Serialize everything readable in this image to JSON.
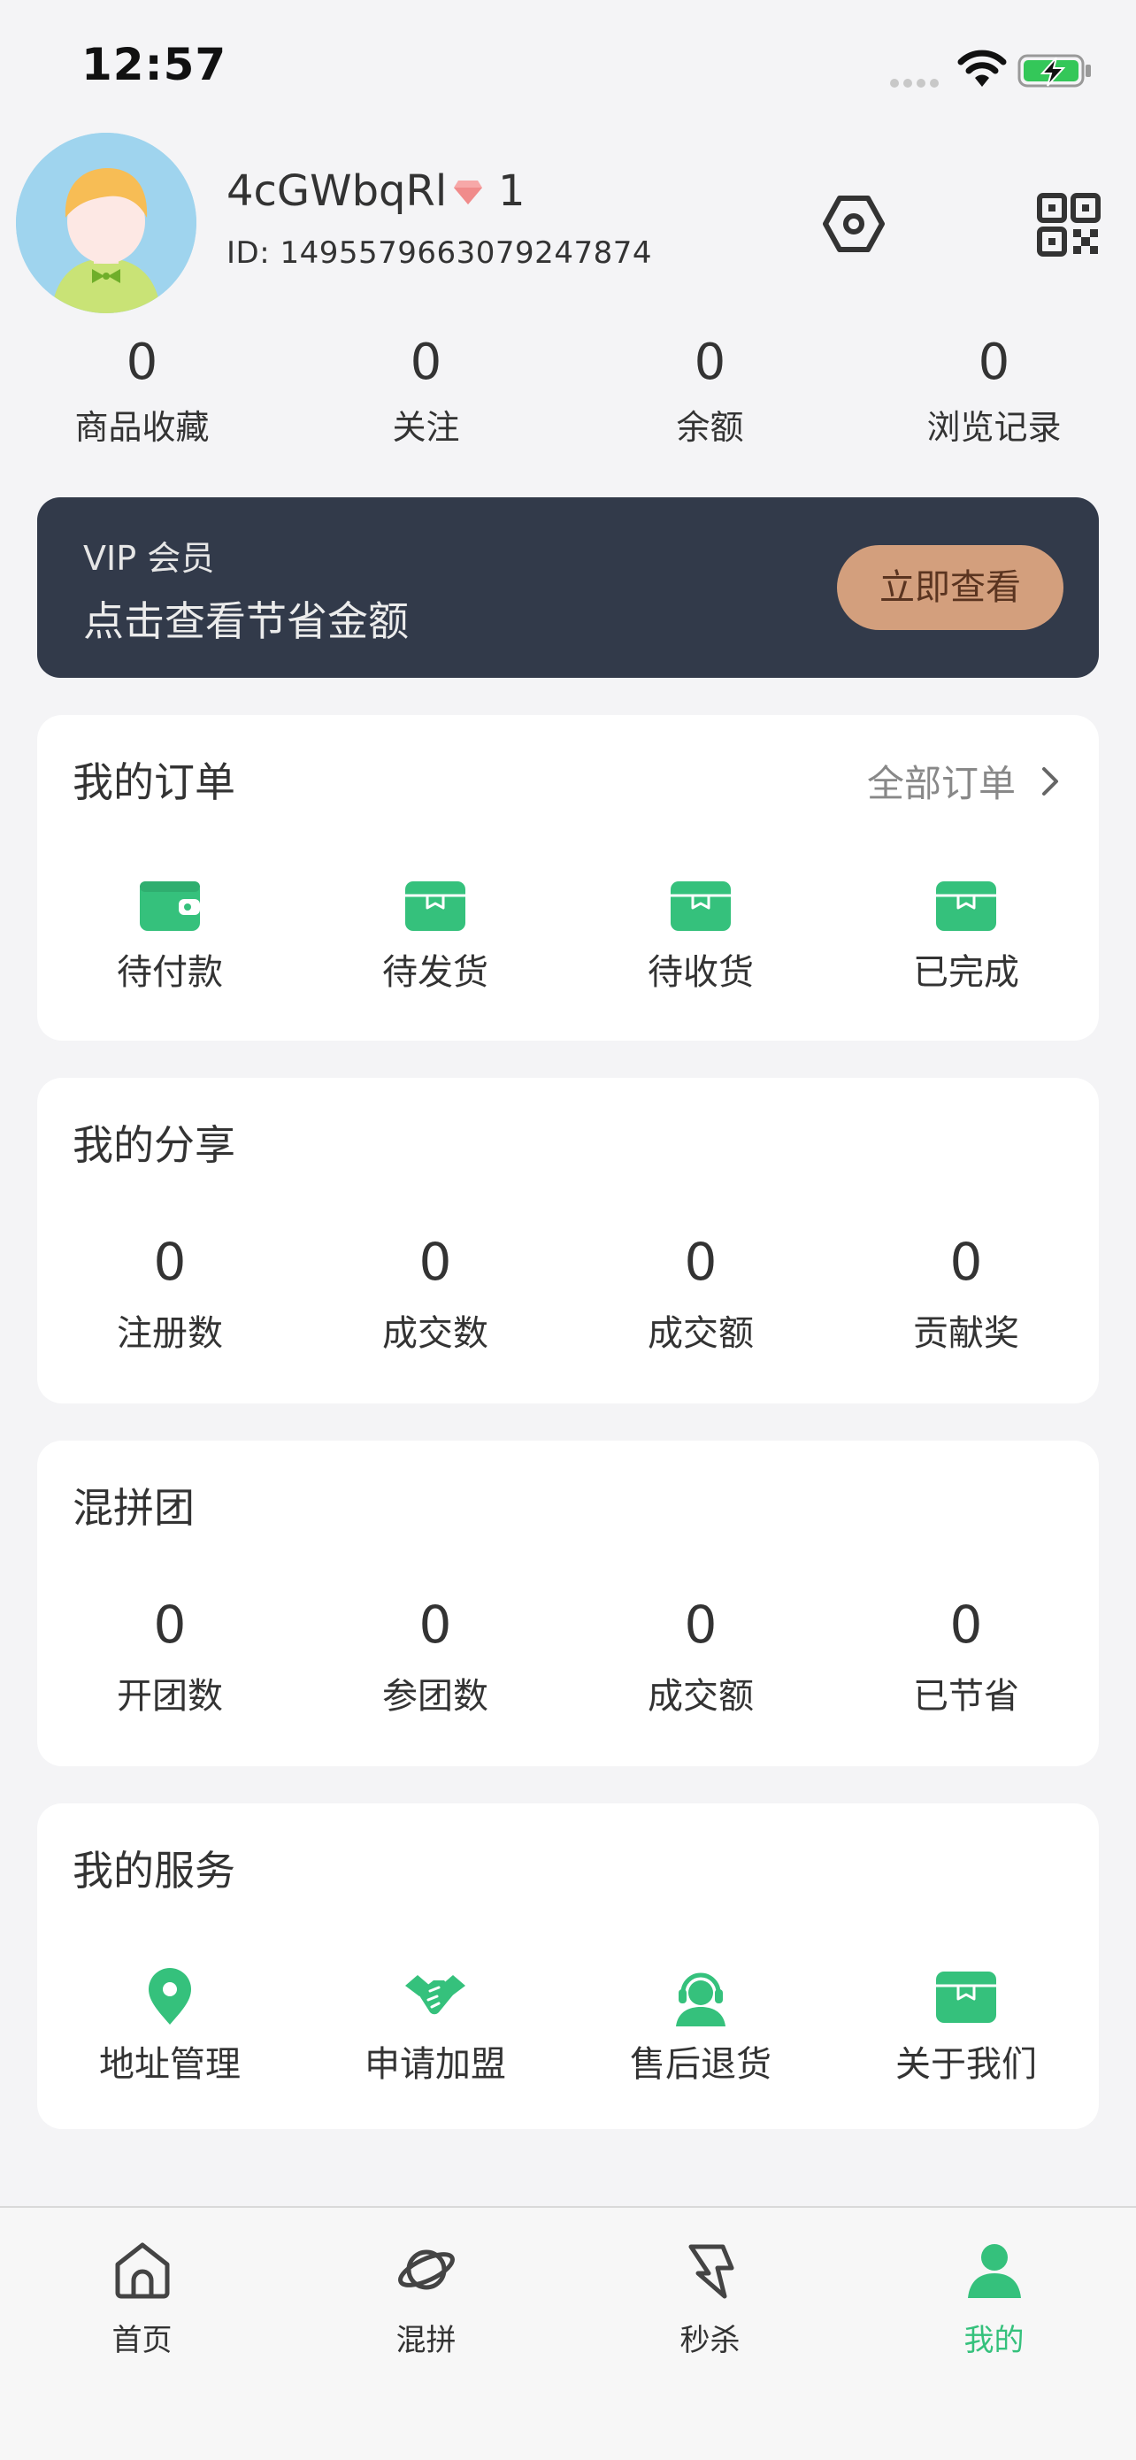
{
  "status_bar": {
    "time": "12:57"
  },
  "profile": {
    "username": "4cGWbqRl",
    "level": "1",
    "user_id": "ID: 1495579663079247874"
  },
  "stats": [
    {
      "value": "0",
      "label": "商品收藏"
    },
    {
      "value": "0",
      "label": "关注"
    },
    {
      "value": "0",
      "label": "余额"
    },
    {
      "value": "0",
      "label": "浏览记录"
    }
  ],
  "vip": {
    "title": "VIP 会员",
    "subtitle": "点击查看节省金额",
    "button": "立即查看"
  },
  "orders": {
    "title": "我的订单",
    "link": "全部订单",
    "items": [
      {
        "label": "待付款",
        "icon": "wallet-icon"
      },
      {
        "label": "待发货",
        "icon": "box-icon"
      },
      {
        "label": "待收货",
        "icon": "box-icon"
      },
      {
        "label": "已完成",
        "icon": "box-icon"
      }
    ]
  },
  "share": {
    "title": "我的分享",
    "items": [
      {
        "value": "0",
        "label": "注册数"
      },
      {
        "value": "0",
        "label": "成交数"
      },
      {
        "value": "0",
        "label": "成交额"
      },
      {
        "value": "0",
        "label": "贡献奖"
      }
    ]
  },
  "group": {
    "title": "混拼团",
    "items": [
      {
        "value": "0",
        "label": "开团数"
      },
      {
        "value": "0",
        "label": "参团数"
      },
      {
        "value": "0",
        "label": "成交额"
      },
      {
        "value": "0",
        "label": "已节省"
      }
    ]
  },
  "services": {
    "title": "我的服务",
    "items": [
      {
        "label": "地址管理",
        "icon": "location-pin-icon"
      },
      {
        "label": "申请加盟",
        "icon": "handshake-icon"
      },
      {
        "label": "售后退货",
        "icon": "customer-service-icon"
      },
      {
        "label": "关于我们",
        "icon": "box-icon"
      }
    ]
  },
  "tabbar": [
    {
      "label": "首页",
      "icon": "home-icon"
    },
    {
      "label": "混拼",
      "icon": "planet-icon"
    },
    {
      "label": "秒杀",
      "icon": "flash-icon"
    },
    {
      "label": "我的",
      "icon": "user-icon",
      "active": true
    }
  ],
  "colors": {
    "accent": "#35c17c",
    "vip_bg": "#323a4a",
    "vip_button": "#d39f7d"
  }
}
